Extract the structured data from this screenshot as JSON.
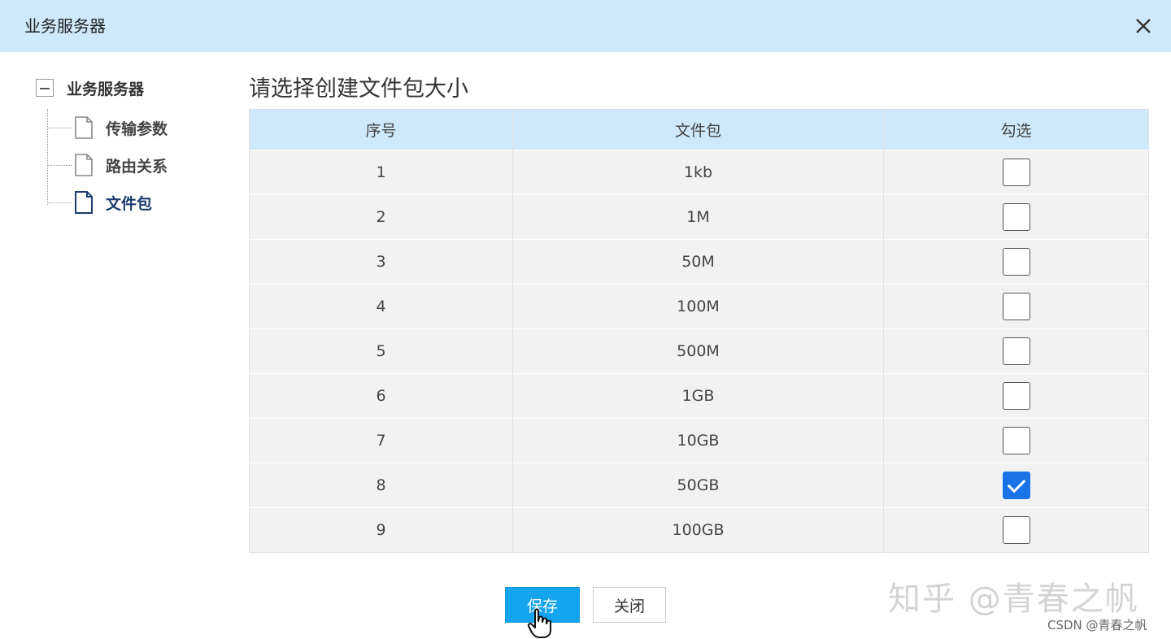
{
  "header": {
    "title": "业务服务器"
  },
  "tree": {
    "root_label": "业务服务器",
    "items": [
      {
        "label": "传输参数",
        "active": false
      },
      {
        "label": "路由关系",
        "active": false
      },
      {
        "label": "文件包",
        "active": true
      }
    ]
  },
  "main": {
    "title": "请选择创建文件包大小",
    "columns": [
      "序号",
      "文件包",
      "勾选"
    ],
    "rows": [
      {
        "index": "1",
        "size": "1kb",
        "checked": false
      },
      {
        "index": "2",
        "size": "1M",
        "checked": false
      },
      {
        "index": "3",
        "size": "50M",
        "checked": false
      },
      {
        "index": "4",
        "size": "100M",
        "checked": false
      },
      {
        "index": "5",
        "size": "500M",
        "checked": false
      },
      {
        "index": "6",
        "size": "1GB",
        "checked": false
      },
      {
        "index": "7",
        "size": "10GB",
        "checked": false
      },
      {
        "index": "8",
        "size": "50GB",
        "checked": true
      },
      {
        "index": "9",
        "size": "100GB",
        "checked": false
      }
    ]
  },
  "buttons": {
    "save_label": "保存",
    "close_label": "关闭"
  },
  "watermark": {
    "main": "知乎 @青春之帆",
    "small": "CSDN @青春之帆"
  },
  "colors": {
    "header_bg": "#cde9fb",
    "accent": "#15a4ee",
    "checkbox_checked": "#1a73e8"
  }
}
